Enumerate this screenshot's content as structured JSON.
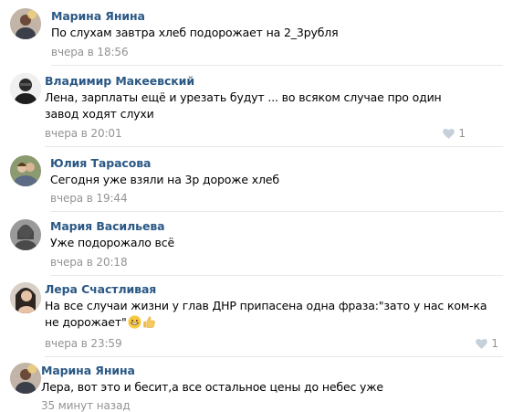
{
  "comments": [
    {
      "author": "Марина Янина",
      "text": "По слухам завтра хлеб подорожает на 2_3рубля",
      "time": "вчера в 18:56",
      "likes": "",
      "avatar_color": "#b3a59a"
    },
    {
      "author": "Владимир Макеевский",
      "text": "Лена, зарплаты ещё и урезать будут ... во всяком случае про один завод ходят слухи",
      "time": "вчера в 20:01",
      "likes": "1",
      "avatar_color": "#3a3a3a"
    },
    {
      "author": "Юлия Тарасова",
      "text": "Сегодня уже взяли на 3р дороже хлеб",
      "time": "вчера в 19:44",
      "likes": "",
      "avatar_color": "#7d8a6a"
    },
    {
      "author": "Мария Васильева",
      "text": "Уже подорожало всё",
      "time": "вчера в 20:18",
      "likes": "",
      "avatar_color": "#8a8a8a"
    },
    {
      "author": "Лера Счастливая",
      "text": "На все случаи жизни у глав ДНР припасена одна фраза:\"зато у нас ком-ка не дорожает\"",
      "time": "вчера в 23:59",
      "likes": "1",
      "avatar_color": "#5a4a40"
    },
    {
      "author": "Марина Янина",
      "text": "Лера, вот это и бесит,а все остальное цены до небес уже",
      "time": "35 минут назад",
      "likes": "",
      "avatar_color": "#b3a59a"
    }
  ],
  "icons": {
    "like": "heart-icon",
    "emoji_1": "grinning-face-icon",
    "emoji_2": "thumbs-up-icon"
  },
  "colors": {
    "author_link": "#2a5885",
    "meta_gray": "#939393",
    "divider": "#e7e8ec"
  }
}
